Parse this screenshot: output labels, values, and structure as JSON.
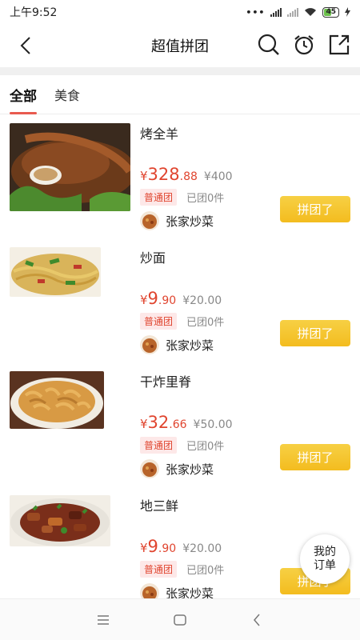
{
  "status_bar": {
    "time": "上午9:52",
    "battery": "45"
  },
  "header": {
    "title": "超值拼团"
  },
  "tabs": [
    {
      "label": "全部"
    },
    {
      "label": "美食"
    }
  ],
  "items": [
    {
      "name": "烤全羊",
      "price_symbol": "¥",
      "price_int": "328",
      "price_dec": ".88",
      "original_price": "¥400",
      "badge": "普通团",
      "joined": "已团0件",
      "shop": "张家炒菜",
      "button": "拼团了"
    },
    {
      "name": "炒面",
      "price_symbol": "¥",
      "price_int": "9",
      "price_dec": ".90",
      "original_price": "¥20.00",
      "badge": "普通团",
      "joined": "已团0件",
      "shop": "张家炒菜",
      "button": "拼团了"
    },
    {
      "name": "干炸里脊",
      "price_symbol": "¥",
      "price_int": "32",
      "price_dec": ".66",
      "original_price": "¥50.00",
      "badge": "普通团",
      "joined": "已团0件",
      "shop": "张家炒菜",
      "button": "拼团了"
    },
    {
      "name": "地三鲜",
      "price_symbol": "¥",
      "price_int": "9",
      "price_dec": ".90",
      "original_price": "¥20.00",
      "badge": "普通团",
      "joined": "已团0件",
      "shop": "张家炒菜",
      "button": "拼团了"
    }
  ],
  "floating": {
    "line1": "我的",
    "line2": "订单"
  },
  "colors": {
    "accent": "#e0452f",
    "button": "#f5c52d",
    "tab_underline": "#e85a4f"
  }
}
